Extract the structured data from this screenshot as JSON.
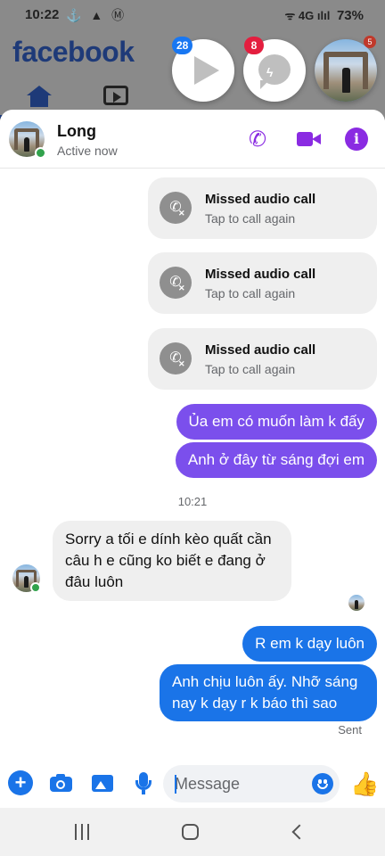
{
  "status_bar": {
    "time": "10:22",
    "left_icons": "⚓ ▲ Ⓜ",
    "right_icons": "ᯤ 4G ılıl",
    "battery": "73%"
  },
  "background_app": {
    "logo": "facebook",
    "tabs": [
      "home-icon",
      "watch-icon"
    ]
  },
  "chat_heads": {
    "watch_badge": "28",
    "messenger_badge": "8",
    "avatar_badge": "5"
  },
  "header": {
    "contact_name": "Long",
    "status": "Active now",
    "icons": [
      "phone-icon",
      "video-call-icon",
      "info-icon"
    ],
    "accent_color": "#8a2be2"
  },
  "messages": {
    "missed_calls": [
      {
        "title": "Missed audio call",
        "subtitle": "Tap to call again"
      },
      {
        "title": "Missed audio call",
        "subtitle": "Tap to call again"
      },
      {
        "title": "Missed audio call",
        "subtitle": "Tap to call again"
      }
    ],
    "outgoing_1": "Ủa em có muốn làm k đấy",
    "outgoing_2": "Anh ở đây từ sáng đợi em",
    "timestamp": "10:21",
    "incoming_1": "Sorry a tối e dính kèo quất cần câu h e cũng ko biết e đang ở đâu luôn",
    "outgoing_3": "R em k dạy luôn",
    "outgoing_4": "Anh chịu luôn ấy. Nhỡ sáng nay k dạy r k báo thì sao",
    "sent_label": "Sent"
  },
  "composer": {
    "placeholder": "Message",
    "icons": [
      "plus-icon",
      "camera-icon",
      "gallery-icon",
      "mic-icon",
      "emoji-icon",
      "like-icon"
    ],
    "accent_color": "#1a74e8"
  },
  "navbar": {
    "icons": [
      "recents-icon",
      "home-icon",
      "back-icon"
    ]
  }
}
